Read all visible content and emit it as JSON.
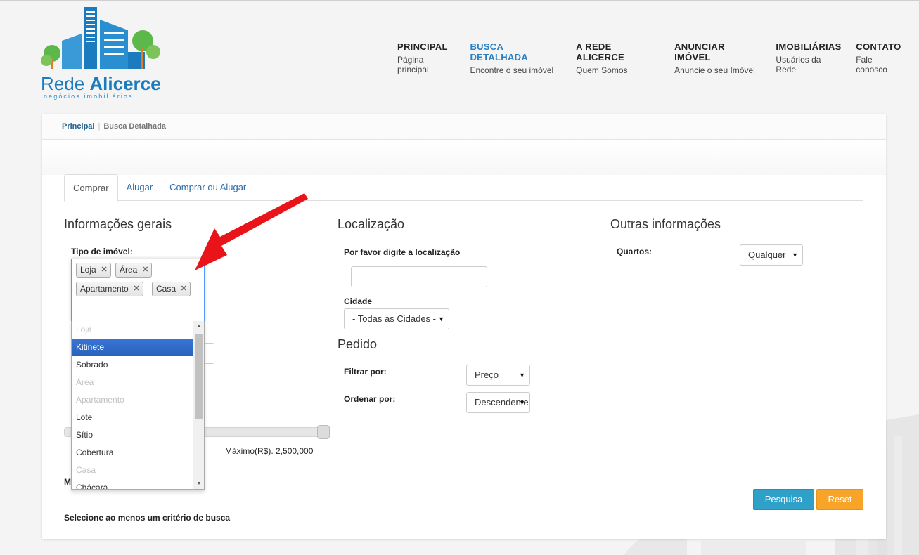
{
  "brand": {
    "name_light": "Rede ",
    "name_bold": "Alicerce",
    "tagline": "negócios imobiliários",
    "color": "#1a7bbf"
  },
  "nav": [
    {
      "title": "PRINCIPAL",
      "subtitle": "Página principal",
      "active": false
    },
    {
      "title": "BUSCA DETALHADA",
      "subtitle": "Encontre o seu imóvel",
      "active": true
    },
    {
      "title": "A REDE ALICERCE",
      "subtitle": "Quem Somos",
      "active": false
    },
    {
      "title": "ANUNCIAR IMÓVEL",
      "subtitle": "Anuncie o seu Imóvel",
      "active": false
    },
    {
      "title": "IMOBILIÁRIAS",
      "subtitle": "Usuários da Rede",
      "active": false
    },
    {
      "title": "CONTATO",
      "subtitle": "Fale conosco",
      "active": false
    }
  ],
  "breadcrumb": {
    "home": "Principal",
    "current": "Busca Detalhada"
  },
  "tabs": [
    "Comprar",
    "Alugar",
    "Comprar ou Alugar"
  ],
  "general": {
    "heading": "Informações gerais",
    "type_label": "Tipo de imóvel:",
    "selected": [
      "Loja",
      "Área",
      "Apartamento",
      "Casa"
    ],
    "options": [
      {
        "label": "Loja",
        "state": "disabled"
      },
      {
        "label": "Kitinete",
        "state": "highlighted"
      },
      {
        "label": "Sobrado",
        "state": "normal"
      },
      {
        "label": "Área",
        "state": "disabled"
      },
      {
        "label": "Apartamento",
        "state": "disabled"
      },
      {
        "label": "Lote",
        "state": "normal"
      },
      {
        "label": "Sítio",
        "state": "normal"
      },
      {
        "label": "Cobertura",
        "state": "normal"
      },
      {
        "label": "Casa",
        "state": "disabled"
      },
      {
        "label": "Chácara",
        "state": "normal"
      }
    ],
    "max_price": "Máximo(R$). 2,500,000",
    "hidden_label_partial": "M",
    "hint": "Selecione ao menos um critério de busca"
  },
  "location": {
    "heading": "Localização",
    "prompt": "Por favor digite a localização",
    "input_value": "",
    "city_label": "Cidade",
    "city_value": "- Todas as Cidades -"
  },
  "order": {
    "heading": "Pedido",
    "filter_label": "Filtrar por:",
    "filter_value": "Preço",
    "sort_label": "Ordenar por:",
    "sort_value": "Descendente"
  },
  "other": {
    "heading": "Outras informações",
    "rooms_label": "Quartos:",
    "rooms_value": "Qualquer"
  },
  "buttons": {
    "search": "Pesquisa",
    "reset": "Reset"
  },
  "colors": {
    "accent_blue": "#2fa0c8",
    "accent_orange": "#f8a428",
    "arrow_red": "#e8141a",
    "highlight": "#3875d7"
  }
}
